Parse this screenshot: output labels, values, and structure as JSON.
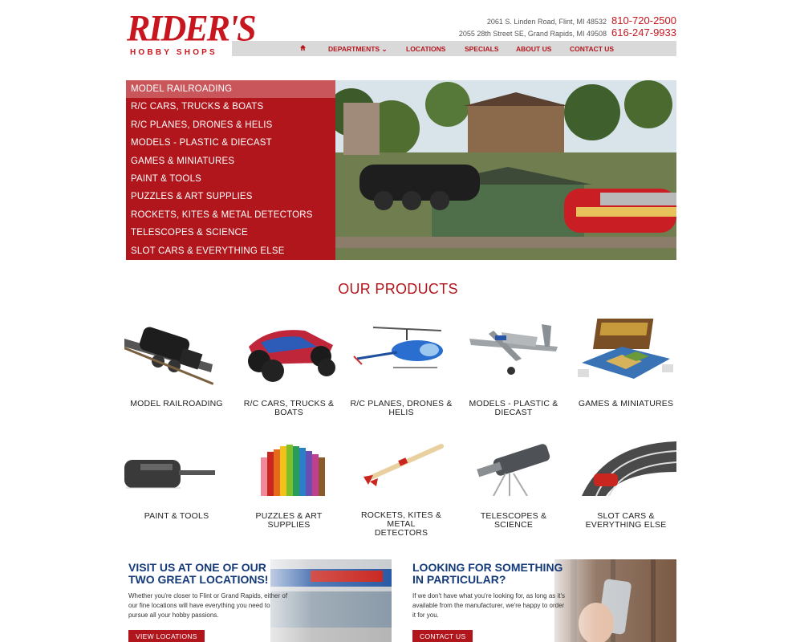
{
  "brand": {
    "logo_text": "RIDER'S",
    "logo_sub": "HOBBY SHOPS",
    "color": "#c8161e"
  },
  "contact": {
    "address1": "2061 S. Linden Road, Flint, MI 48532",
    "phone1": "810-720-2500",
    "address2": "2055 28th Street SE, Grand Rapids, MI 49508",
    "phone2": "616-247-9933"
  },
  "nav": {
    "home_icon": "home-icon",
    "departments": "DEPARTMENTS",
    "locations": "LOCATIONS",
    "specials": "SPECIALS",
    "about": "ABOUT US",
    "contact": "CONTACT US"
  },
  "menu": {
    "items": [
      "MODEL RAILROADING",
      "R/C CARS, TRUCKS & BOATS",
      "R/C PLANES, DRONES & HELIS",
      "MODELS - PLASTIC & DIECAST",
      "GAMES & MINIATURES",
      "PAINT & TOOLS",
      "PUZZLES & ART SUPPLIES",
      "ROCKETS, KITES & METAL DETECTORS",
      "TELESCOPES & SCIENCE",
      "SLOT CARS & EVERYTHING ELSE"
    ]
  },
  "products": {
    "title": "OUR PRODUCTS",
    "items": [
      {
        "label_l1": "MODEL RAILROADING",
        "label_l2": ""
      },
      {
        "label_l1": "R/C CARS, TRUCKS &",
        "label_l2": "BOATS"
      },
      {
        "label_l1": "R/C PLANES, DRONES &",
        "label_l2": "HELIS"
      },
      {
        "label_l1": "MODELS - PLASTIC &",
        "label_l2": "DIECAST"
      },
      {
        "label_l1": "GAMES & MINIATURES",
        "label_l2": ""
      },
      {
        "label_l1": "PAINT & TOOLS",
        "label_l2": ""
      },
      {
        "label_l1": "PUZZLES & ART SUPPLIES",
        "label_l2": ""
      },
      {
        "label_l1": "ROCKETS, KITES & METAL",
        "label_l2": "DETECTORS"
      },
      {
        "label_l1": "TELESCOPES & SCIENCE",
        "label_l2": ""
      },
      {
        "label_l1": "SLOT CARS &",
        "label_l2": "EVERYTHING ELSE"
      }
    ]
  },
  "promo_locations": {
    "title": "VISIT US AT ONE OF OUR TWO GREAT LOCATIONS!",
    "body": "Whether you're closer to Flint or Grand Rapids, either of our fine locations will have everything you need to pursue all your hobby passions.",
    "button": "VIEW LOCATIONS"
  },
  "promo_order": {
    "title": "LOOKING FOR SOMETHING IN PARTICULAR?",
    "body": "If we don't have what you're looking for, as long as it's available from the manufacturer, we're happy to order it for you.",
    "button": "CONTACT US"
  }
}
